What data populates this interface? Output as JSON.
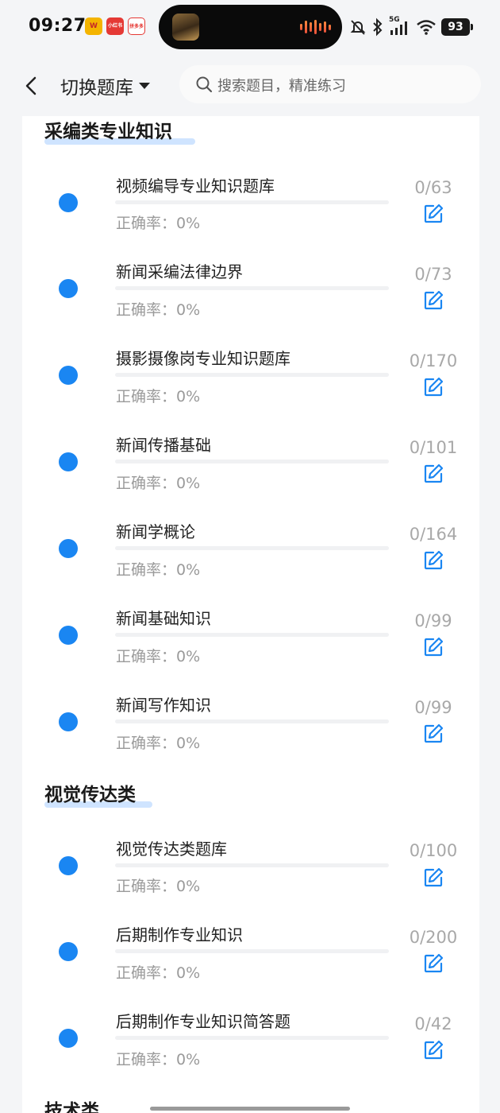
{
  "status_bar": {
    "time": "09:27",
    "app_icons": [
      "W",
      "小红书",
      "拼多多"
    ],
    "network_label": "5G",
    "battery": "93"
  },
  "header": {
    "back_icon": "chevron-left-icon",
    "title": "切换题库",
    "dropdown_icon": "caret-down-icon",
    "search_placeholder": "搜索题目，精准练习"
  },
  "accent_color": "#1a86f2",
  "sections": [
    {
      "title": "采编类专业知识",
      "items": [
        {
          "name": "视频编导专业知识题库",
          "accuracy": "正确率：0%",
          "count": "0/63",
          "progress": 0
        },
        {
          "name": "新闻采编法律边界",
          "accuracy": "正确率：0%",
          "count": "0/73",
          "progress": 0
        },
        {
          "name": "摄影摄像岗专业知识题库",
          "accuracy": "正确率：0%",
          "count": "0/170",
          "progress": 0
        },
        {
          "name": "新闻传播基础",
          "accuracy": "正确率：0%",
          "count": "0/101",
          "progress": 0
        },
        {
          "name": "新闻学概论",
          "accuracy": "正确率：0%",
          "count": "0/164",
          "progress": 0
        },
        {
          "name": "新闻基础知识",
          "accuracy": "正确率：0%",
          "count": "0/99",
          "progress": 0
        },
        {
          "name": "新闻写作知识",
          "accuracy": "正确率：0%",
          "count": "0/99",
          "progress": 0
        }
      ]
    },
    {
      "title": "视觉传达类",
      "items": [
        {
          "name": "视觉传达类题库",
          "accuracy": "正确率：0%",
          "count": "0/100",
          "progress": 0
        },
        {
          "name": "后期制作专业知识",
          "accuracy": "正确率：0%",
          "count": "0/200",
          "progress": 0
        },
        {
          "name": "后期制作专业知识简答题",
          "accuracy": "正确率：0%",
          "count": "0/42",
          "progress": 0
        }
      ]
    },
    {
      "title": "技术类",
      "items": []
    }
  ]
}
